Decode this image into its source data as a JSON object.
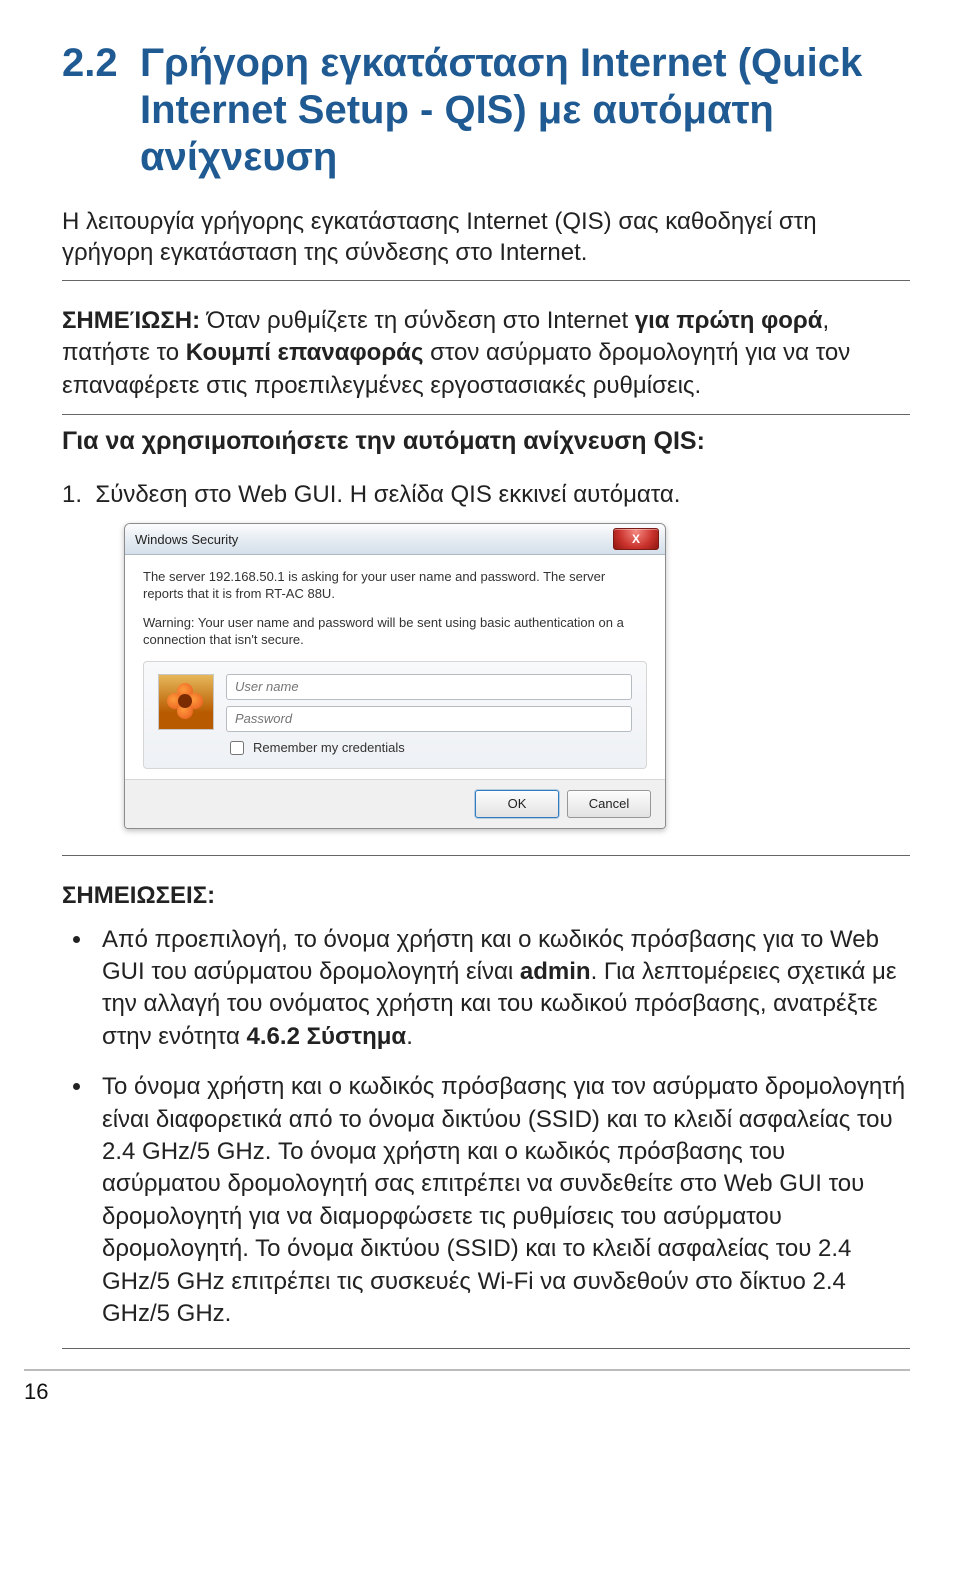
{
  "section": {
    "number": "2.2",
    "title": "Γρήγορη εγκατάσταση Internet (Quick Internet Setup - QIS) με αυτόματη ανίχνευση"
  },
  "intro": "Η λειτουργία γρήγορης εγκατάστασης Internet (QIS) σας καθοδηγεί στη γρήγορη εγκατάσταση της σύνδεσης στο Internet.",
  "note1": {
    "label": "ΣΗΜΕΊΩΣΗ:",
    "part1": " Όταν ρυθμίζετε τη σύνδεση στο Internet ",
    "bold1": "για πρώτη φορά",
    "part2": ", πατήστε το ",
    "bold2": "Κουμπί επαναφοράς",
    "part3": " στον ασύρματο δρομολογητή για να τον επαναφέρετε στις προεπιλεγμένες εργοστασιακές ρυθμίσεις."
  },
  "subhead": "Για να χρησιμοποιήσετε την αυτόματη ανίχνευση QIS:",
  "step1": "1.  Σύνδεση στο Web GUI. Η σελίδα QIS εκκινεί αυτόματα.",
  "dialog": {
    "title": "Windows Security",
    "close": "X",
    "msg1": "The server 192.168.50.1 is asking for your user name and password. The server reports that it is from RT-AC 88U.",
    "msg2": "Warning: Your user name and password will be sent using basic authentication on a connection that isn't secure.",
    "ph_user": "User name",
    "ph_pass": "Password",
    "remember": "Remember my credentials",
    "ok": "OK",
    "cancel": "Cancel"
  },
  "notes_head": "ΣΗΜΕΙΩΣΕΙΣ:",
  "bullet1": {
    "part1": "Από προεπιλογή, το όνομα χρήστη και ο κωδικός πρόσβασης για το Web GUI του ασύρματου δρομολογητή είναι ",
    "bold1": "admin",
    "part2": ". Για λεπτομέρειες σχετικά με την αλλαγή του ονόματος χρήστη και του κωδικού πρόσβασης, ανατρέξτε στην ενότητα ",
    "bold2": "4.6.2 Σύστημα",
    "part3": "."
  },
  "bullet2": "Το όνομα χρήστη και ο κωδικός πρόσβασης για τον ασύρματο δρομολογητή είναι διαφορετικά από το όνομα δικτύου (SSID) και το κλειδί ασφαλείας του 2.4 GHz/5 GHz. Το όνομα χρήστη και ο κωδικός πρόσβασης του ασύρματου δρομολογητή σας επιτρέπει να συνδεθείτε στο Web GUI του δρομολογητή για να διαμορφώσετε τις ρυθμίσεις του ασύρματου δρομολογητή. Το όνομα δικτύου (SSID) και το κλειδί ασφαλείας του 2.4 GHz/5 GHz επιτρέπει τις συσκευές Wi-Fi να συνδεθούν στο δίκτυο 2.4 GHz/5 GHz.",
  "page_number": "16"
}
